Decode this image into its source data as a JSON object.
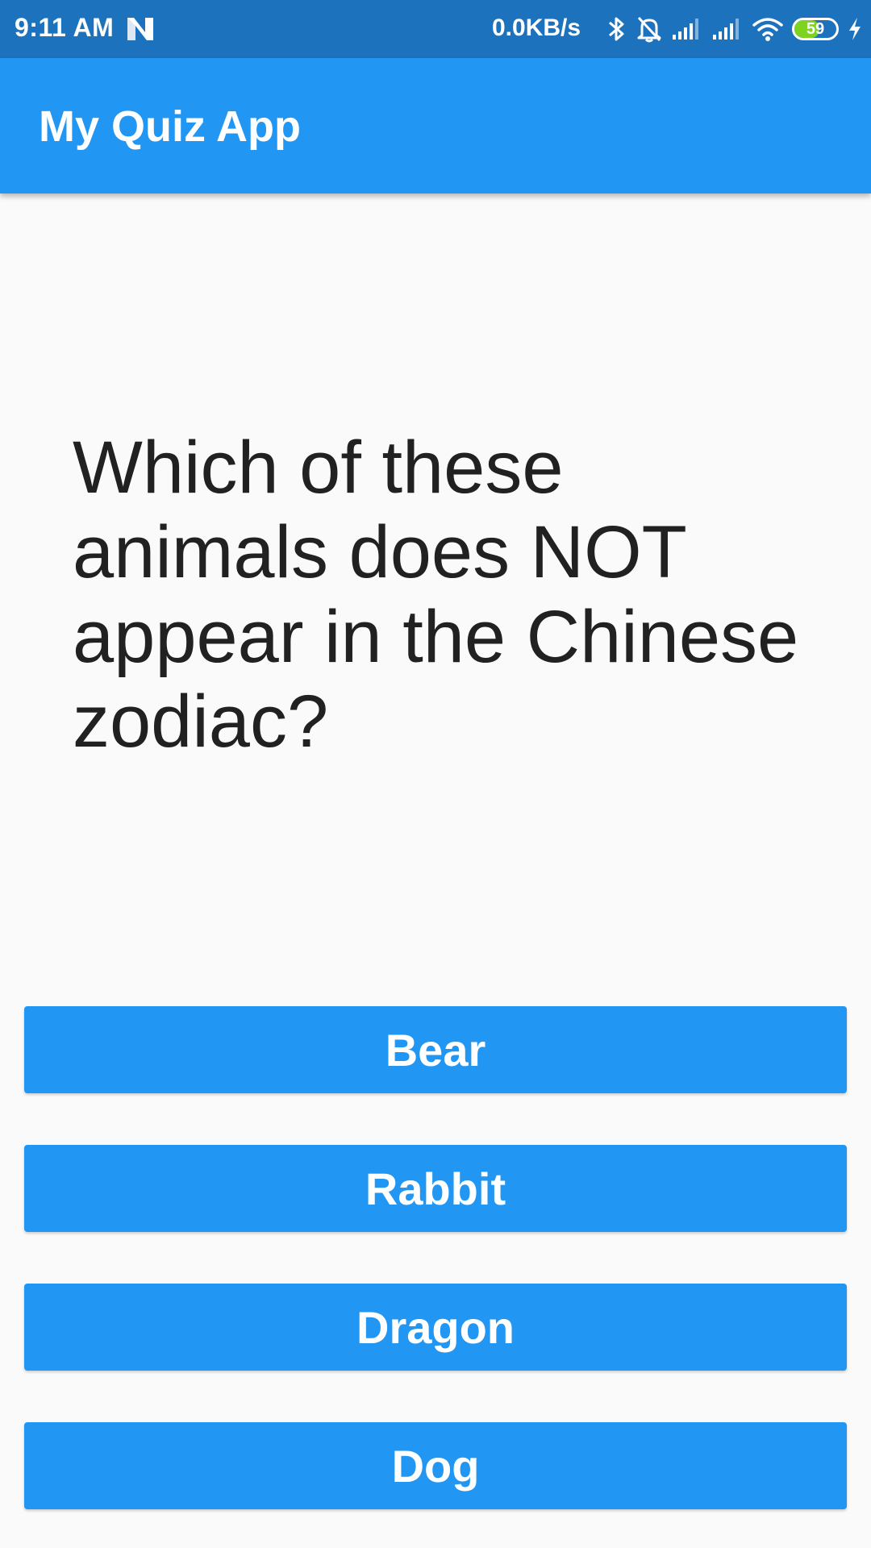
{
  "status_bar": {
    "time": "9:11 AM",
    "network_speed": "0.0KB/s",
    "battery_level": "59",
    "battery_fraction": 0.59,
    "icons": [
      "n-notification-icon",
      "bluetooth-icon",
      "notifications-off-icon",
      "signal-icon",
      "signal-icon",
      "wifi-icon",
      "battery-icon",
      "charging-icon"
    ],
    "background_color": "#1d72bd"
  },
  "app_bar": {
    "title": "My Quiz App",
    "background_color": "#2196f3"
  },
  "question": {
    "text": "Which of these animals does NOT appear in the Chinese zodiac?"
  },
  "answers": [
    {
      "label": "Bear"
    },
    {
      "label": "Rabbit"
    },
    {
      "label": "Dragon"
    },
    {
      "label": "Dog"
    }
  ],
  "colors": {
    "accent": "#2196f3",
    "background": "#fafafa",
    "text": "#212121",
    "battery_fill": "#7ed321"
  }
}
